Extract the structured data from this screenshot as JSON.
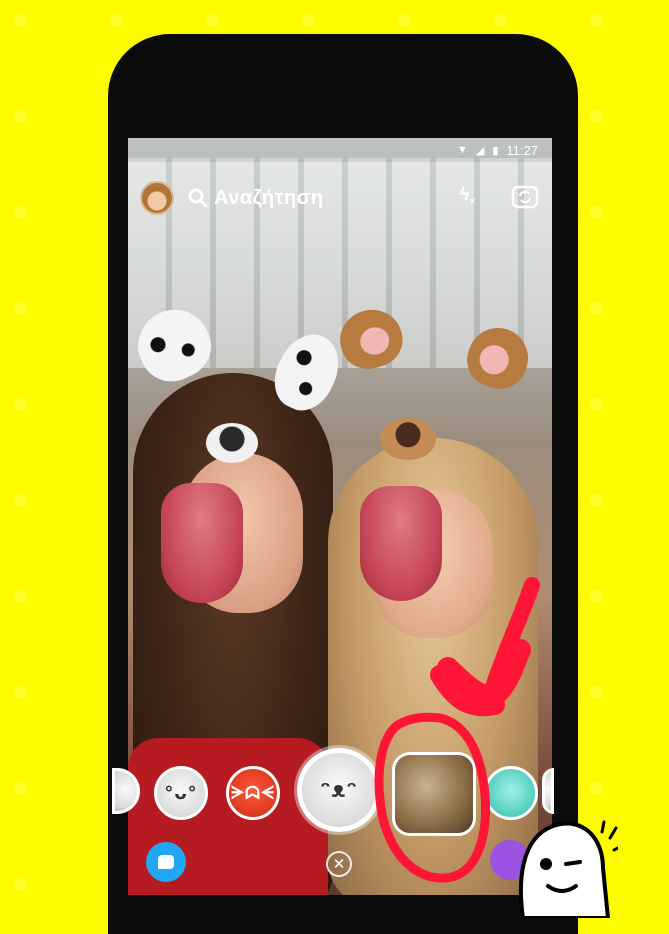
{
  "status_bar": {
    "time": "11:27",
    "icons": [
      "wifi-icon",
      "signal-icon",
      "battery-icon"
    ]
  },
  "top_bar": {
    "search_label": "Αναζήτηση",
    "icons": [
      "avatar",
      "search-icon",
      "flash-off-icon",
      "flip-camera-icon"
    ]
  },
  "lenses": [
    {
      "name": "lens-partial-left"
    },
    {
      "name": "lens-smile-face"
    },
    {
      "name": "lens-devil-face"
    },
    {
      "name": "lens-dog-selected"
    },
    {
      "name": "lens-sloth"
    },
    {
      "name": "lens-teal-face"
    },
    {
      "name": "lens-partial-right"
    }
  ],
  "bottom_bar": {
    "icons": [
      "chat-icon",
      "close-icon",
      "discover-icon"
    ]
  },
  "colors": {
    "background": "#FFFC00",
    "annotation": "#ff1535",
    "chat": "#1fa7f3",
    "discover": "#9b53e2"
  }
}
